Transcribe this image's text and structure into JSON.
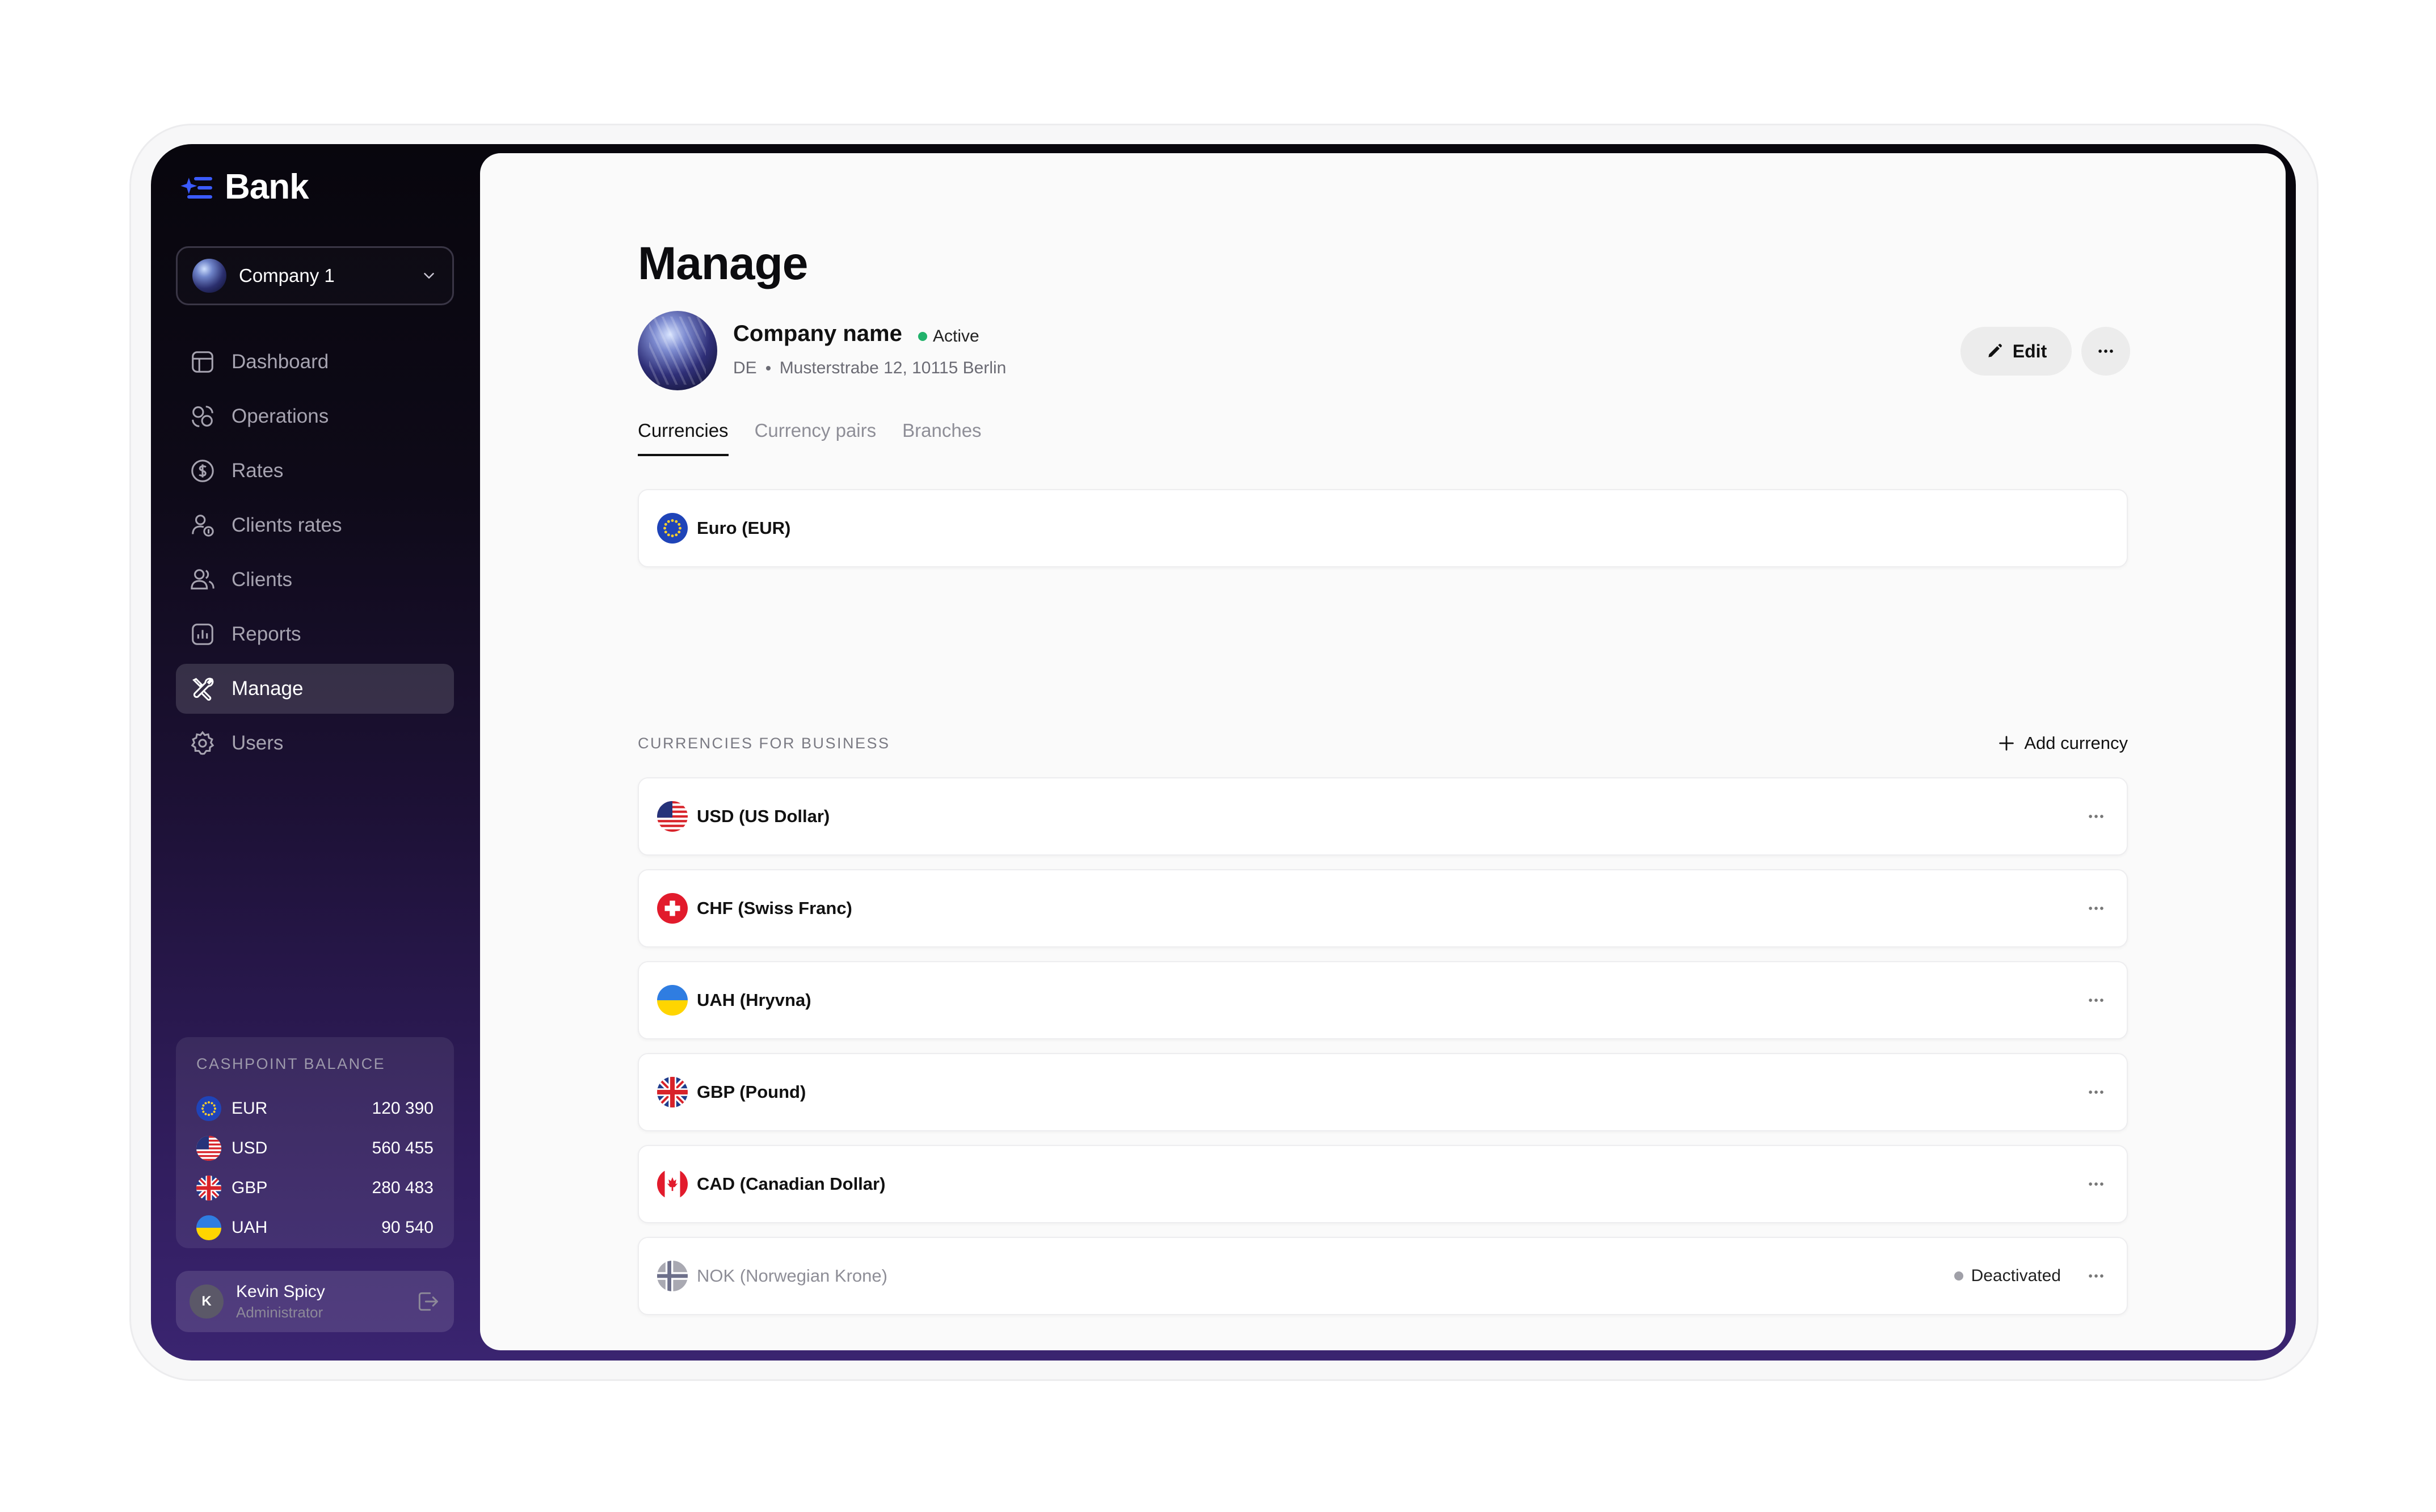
{
  "app": {
    "name": "Bank"
  },
  "sidebar": {
    "company_selector": {
      "label": "Company 1"
    },
    "nav": [
      {
        "label": "Dashboard",
        "icon": "dashboard-icon"
      },
      {
        "label": "Operations",
        "icon": "operations-icon"
      },
      {
        "label": "Rates",
        "icon": "dollar-circle-icon"
      },
      {
        "label": "Clients rates",
        "icon": "user-coin-icon"
      },
      {
        "label": "Clients",
        "icon": "users-icon"
      },
      {
        "label": "Reports",
        "icon": "chart-icon"
      },
      {
        "label": "Manage",
        "icon": "tools-icon",
        "active": true
      },
      {
        "label": "Users",
        "icon": "gear-icon"
      }
    ],
    "balance": {
      "title": "CASHPOINT BALANCE",
      "rows": [
        {
          "code": "EUR",
          "amount": "120 390",
          "flag": "eu-flag-icon"
        },
        {
          "code": "USD",
          "amount": "560 455",
          "flag": "us-flag-icon"
        },
        {
          "code": "GBP",
          "amount": "280 483",
          "flag": "uk-flag-icon"
        },
        {
          "code": "UAH",
          "amount": "90 540",
          "flag": "ua-flag-icon"
        }
      ]
    },
    "user": {
      "initial": "K",
      "name": "Kevin Spicy",
      "role": "Administrator"
    }
  },
  "main": {
    "title": "Manage",
    "company": {
      "name": "Company name",
      "status": "Active",
      "country": "DE",
      "address": "Musterstrabe 12, 10115 Berlin"
    },
    "actions": {
      "edit_label": "Edit"
    },
    "tabs": [
      {
        "label": "Currencies",
        "active": true
      },
      {
        "label": "Currency pairs"
      },
      {
        "label": "Branches"
      }
    ],
    "base_currency": {
      "label": "Euro (EUR)",
      "flag": "eu-flag-icon"
    },
    "business_section": {
      "title": "CURRENCIES FOR BUSINESS",
      "add_label": "Add currency"
    },
    "currencies": [
      {
        "label": "USD (US Dollar)",
        "flag": "us-flag-icon"
      },
      {
        "label": "CHF (Swiss Franc)",
        "flag": "ch-flag-icon"
      },
      {
        "label": "UAH (Hryvna)",
        "flag": "ua-flag-icon"
      },
      {
        "label": "GBP (Pound)",
        "flag": "uk-flag-icon"
      },
      {
        "label": "CAD (Canadian Dollar)",
        "flag": "ca-flag-icon"
      },
      {
        "label": "NOK (Norwegian Krone)",
        "flag": "no-flag-icon",
        "status": "Deactivated"
      }
    ]
  },
  "colors": {
    "active_status": "#21b26b",
    "deactivated_status": "#a0a0a8",
    "brand_blue": "#3b5bff",
    "sidebar_gradient_end": "#3a2470"
  }
}
